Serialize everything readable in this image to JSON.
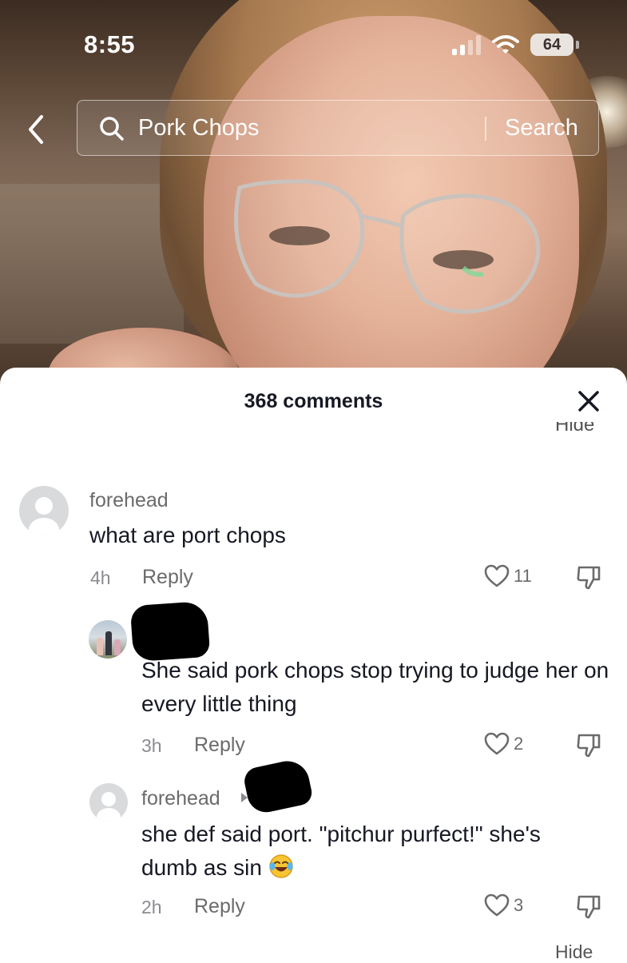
{
  "status_bar": {
    "time": "8:55",
    "battery": "64",
    "icons": [
      "signal-icon",
      "wifi-icon",
      "battery-icon"
    ]
  },
  "search": {
    "query": "Pork Chops",
    "button_label": "Search",
    "icons": [
      "back-chevron-icon",
      "search-icon"
    ]
  },
  "comments_panel": {
    "count_label": "368 comments",
    "hide_label_top": "Hide",
    "hide_label_bottom": "Hide",
    "close_icon": "close-icon",
    "colors": {
      "text_primary": "#161823",
      "text_secondary": "#6b6b6b",
      "redaction": "#000000"
    }
  },
  "comments": [
    {
      "username": "forehead",
      "text": "what are port chops",
      "time": "4h",
      "reply_label": "Reply",
      "likes": "11",
      "avatar": "default-avatar-icon"
    },
    {
      "username": "",
      "text": "She said pork chops stop trying to judge her on every little thing",
      "time": "3h",
      "reply_label": "Reply",
      "likes": "2",
      "avatar": "photo-avatar"
    },
    {
      "username": "forehead",
      "text": "she def said port. \"pitchur purfect!\" she's dumb as sin",
      "time": "2h",
      "reply_label": "Reply",
      "likes": "3",
      "avatar": "default-avatar-icon",
      "emoji": "laughing-crying-emoji"
    }
  ]
}
